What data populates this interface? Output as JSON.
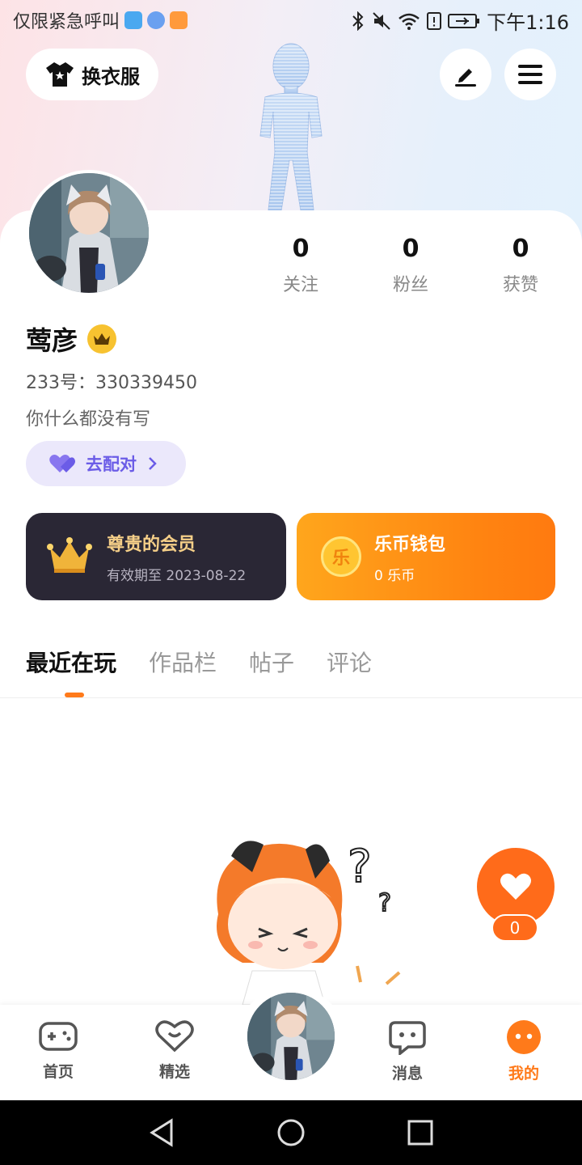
{
  "status_bar": {
    "carrier_text": "仅限紧急呼叫",
    "time": "下午1:16"
  },
  "header": {
    "outfit_button_label": "换衣服",
    "icons": [
      "tshirt-icon",
      "edit-pen-icon",
      "menu-icon"
    ]
  },
  "profile": {
    "stats": [
      {
        "value": "0",
        "label": "关注"
      },
      {
        "value": "0",
        "label": "粉丝"
      },
      {
        "value": "0",
        "label": "获赞"
      }
    ],
    "username": "莺彦",
    "uid_label": "233号：",
    "uid_value": "330339450",
    "bio": "你什么都没有写",
    "match_button_label": "去配对"
  },
  "cards": {
    "vip": {
      "title": "尊贵的会员",
      "subtitle": "有效期至 2023-08-22"
    },
    "wallet": {
      "title": "乐币钱包",
      "subtitle": "0 乐币",
      "coin_glyph": "乐"
    }
  },
  "tabs": [
    {
      "label": "最近在玩",
      "active": true
    },
    {
      "label": "作品栏",
      "active": false
    },
    {
      "label": "帖子",
      "active": false
    },
    {
      "label": "评论",
      "active": false
    }
  ],
  "like_widget": {
    "count": "0"
  },
  "bottom_nav": [
    {
      "label": "首页",
      "icon": "gamepad-icon"
    },
    {
      "label": "精选",
      "icon": "heart-chat-icon"
    },
    {
      "label": "消息",
      "icon": "message-icon"
    },
    {
      "label": "我的",
      "icon": "profile-face-icon",
      "active": true
    }
  ],
  "colors": {
    "accent": "#ff7a1a",
    "vip_card_bg": "#2a2735",
    "vip_title": "#f5cf88",
    "wallet_orange": "#ff8411",
    "match_purple": "#6b5ce7"
  }
}
